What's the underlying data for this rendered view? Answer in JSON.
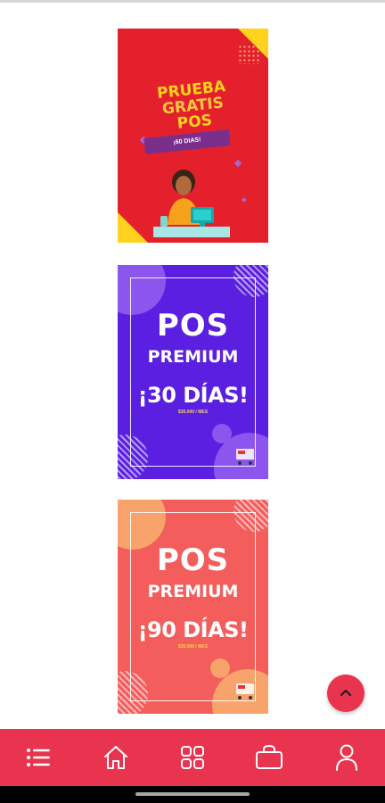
{
  "banners": [
    {
      "title_lines": [
        "PRUEBA",
        "GRATIS",
        "POS"
      ],
      "ribbon": "¡60 DIAS!",
      "colors": {
        "background": "#e3202c",
        "accent": "#ffd21f",
        "ribbon": "#7a2e8c"
      }
    },
    {
      "title": "POS",
      "subtitle": "PREMIUM",
      "days": "¡30 DÍAS!",
      "price": "$35.000 / MES",
      "colors": {
        "background": "#5a1fe0",
        "circles": "#8b55ee",
        "price": "#f5d46a"
      }
    },
    {
      "title": "POS",
      "subtitle": "PREMIUM",
      "days": "¡90 DÍAS!",
      "price": "$35.000 / MES",
      "colors": {
        "background": "#f35d5b",
        "circles": "#f8a36b",
        "price": "#ffd24a"
      }
    }
  ],
  "scroll_top": {
    "icon": "chevron-up-icon",
    "color": "#e8344f"
  },
  "bottom_nav": {
    "color": "#e8344f",
    "items": [
      {
        "icon": "list-icon"
      },
      {
        "icon": "home-icon"
      },
      {
        "icon": "grid-icon"
      },
      {
        "icon": "shopping-bag-icon"
      },
      {
        "icon": "user-icon"
      }
    ]
  }
}
